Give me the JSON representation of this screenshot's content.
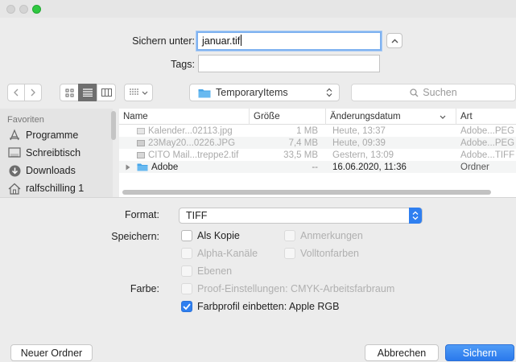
{
  "header": {
    "save_as_label": "Sichern unter:",
    "filename_value": "januar.tif",
    "tags_label": "Tags:",
    "tags_value": ""
  },
  "toolbar": {
    "location": "TemporaryItems",
    "search_placeholder": "Suchen"
  },
  "sidebar": {
    "section_title": "Favoriten",
    "items": [
      {
        "label": "Programme",
        "icon": "applications-icon"
      },
      {
        "label": "Schreibtisch",
        "icon": "desktop-icon"
      },
      {
        "label": "Downloads",
        "icon": "downloads-icon"
      },
      {
        "label": "ralfschilling 1",
        "icon": "home-icon"
      }
    ]
  },
  "file_list": {
    "columns": [
      "Name",
      "Größe",
      "Änderungsdatum",
      "Art"
    ],
    "rows": [
      {
        "name": "Kalender...02113.jpg",
        "size": "1 MB",
        "date": "Heute, 13:37",
        "kind": "Adobe...PEG f",
        "dim": true
      },
      {
        "name": "23May20...0226.JPG",
        "size": "7,4 MB",
        "date": "Heute, 09:39",
        "kind": "Adobe...PEG f",
        "dim": true
      },
      {
        "name": "CITO Mail...treppe2.tif",
        "size": "33,5 MB",
        "date": "Gestern, 13:09",
        "kind": "Adobe...TIFF f",
        "dim": true
      },
      {
        "name": "Adobe",
        "size": "--",
        "date": "16.06.2020, 11:36",
        "kind": "Ordner",
        "dim": false,
        "folder": true
      }
    ]
  },
  "options": {
    "format_label": "Format:",
    "format_value": "TIFF",
    "save_label": "Speichern:",
    "as_copy": "Als Kopie",
    "notes": "Anmerkungen",
    "alpha_channels": "Alpha-Kanäle",
    "spot_colors": "Volltonfarben",
    "layers": "Ebenen",
    "color_label": "Farbe:",
    "proof_setup": "Proof-Einstellungen: CMYK-Arbeitsfarbraum",
    "embed_profile": "Farbprofil einbetten: Apple RGB",
    "embed_profile_checked": true
  },
  "footer": {
    "new_folder": "Neuer Ordner",
    "cancel": "Abbrechen",
    "save": "Sichern"
  },
  "colors": {
    "accent": "#2f7ff0",
    "close_light": "#d4d4d4",
    "zoom_light": "#2fc840"
  }
}
